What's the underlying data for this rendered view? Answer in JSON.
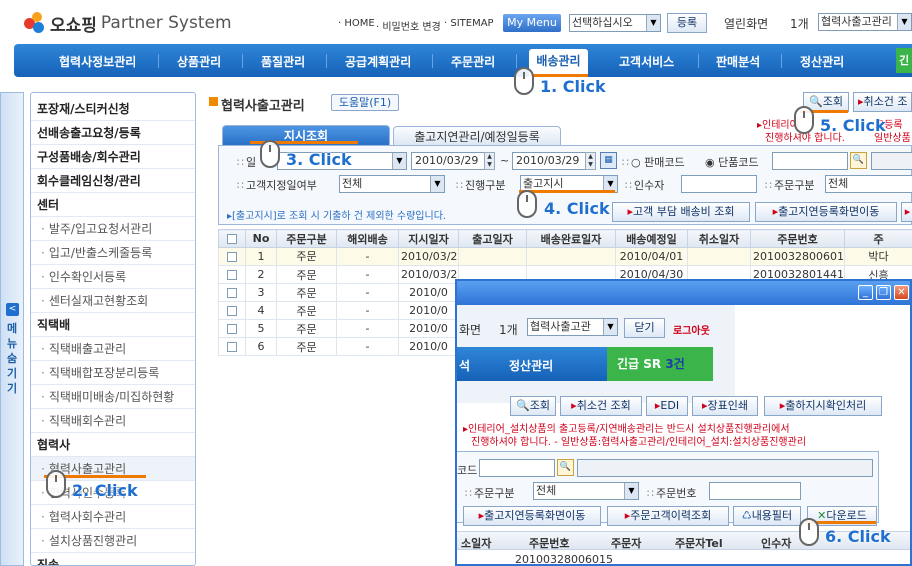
{
  "header": {
    "brand": "오쇼핑",
    "system": "Partner System",
    "links": [
      "HOME",
      "비밀번호 변경",
      "SITEMAP"
    ],
    "my_menu": "My Menu",
    "menu_select": "선택하십시오",
    "register": "등록",
    "open_screens_label": "열린화면",
    "open_screens_count": "1개",
    "open_screen_select": "협력사출고관리"
  },
  "nav": {
    "items": [
      "협력사정보관리",
      "상품관리",
      "품질관리",
      "공급계획관리",
      "주문관리",
      "배송관리",
      "고객서비스",
      "판매분석",
      "정산관리"
    ],
    "active": "배송관리",
    "urgent_prefix": "긴"
  },
  "sidebar": {
    "toggle_label": "메뉴숨기기",
    "items": [
      {
        "label": "포장재/스티커신청",
        "type": "head"
      },
      {
        "label": "선배송출고요청/등록",
        "type": "head"
      },
      {
        "label": "구성품배송/회수관리",
        "type": "head"
      },
      {
        "label": "회수클레임신청/관리",
        "type": "head"
      },
      {
        "label": "센터",
        "type": "head"
      },
      {
        "label": "발주/입고요청서관리",
        "type": "sub"
      },
      {
        "label": "입고/반출스케줄등록",
        "type": "sub"
      },
      {
        "label": "인수확인서등록",
        "type": "sub"
      },
      {
        "label": "센터실재고현황조회",
        "type": "sub"
      },
      {
        "label": "직택배",
        "type": "head"
      },
      {
        "label": "직택배출고관리",
        "type": "sub"
      },
      {
        "label": "직택배합포장분리등록",
        "type": "sub"
      },
      {
        "label": "직택배미배송/미집하현황",
        "type": "sub"
      },
      {
        "label": "직택배회수관리",
        "type": "sub"
      },
      {
        "label": "협력사",
        "type": "head"
      },
      {
        "label": "협력사출고관리",
        "type": "sub"
      },
      {
        "label": "협력사인수등록",
        "type": "sub"
      },
      {
        "label": "협력사회수관리",
        "type": "sub"
      },
      {
        "label": "설치상품진행관리",
        "type": "sub"
      },
      {
        "label": "직송",
        "type": "head"
      }
    ]
  },
  "main": {
    "title": "협력사출고관리",
    "help": "도움말(F1)",
    "search_btn": "조회",
    "cancel_search_btn": "취소건 조",
    "notice_red_1": "인테리어",
    "notice_red_1b": "고등록",
    "notice_red_2": "진행하셔야 합니다.",
    "notice_red_2b": "일반상품",
    "tabs": [
      "지시조회",
      "출고지연관리/예정일등록"
    ],
    "filters": {
      "date_from": "2010/03/29",
      "date_sep": "~",
      "date_to": "2010/03/29",
      "sales_code": "판매코드",
      "single_code": "단품코드",
      "designated_label": "고객지정일여부",
      "designated_value": "전체",
      "status_label": "진행구분",
      "status_value": "출고지시",
      "receiver_label": "인수자",
      "order_type_label": "주문구분",
      "order_type_value": "전체"
    },
    "hint": "[출고지시]로 조회 시 기출하 건 제외한 수량입니다.",
    "actions": [
      "고객 부담 배송비 조회",
      "출고지연등록화면이동"
    ],
    "columns": [
      "",
      "No",
      "주문구분",
      "해외배송",
      "지시일자",
      "출고일자",
      "배송완료일자",
      "배송예정일",
      "취소일자",
      "주문번호",
      "주"
    ],
    "rows": [
      [
        "",
        "1",
        "주문",
        "-",
        "2010/03/29",
        "",
        "",
        "2010/04/01",
        "",
        "20100328006015",
        "박다"
      ],
      [
        "",
        "2",
        "주문",
        "-",
        "2010/03/29",
        "",
        "",
        "2010/04/30",
        "",
        "20100328014417",
        "신흥"
      ],
      [
        "",
        "3",
        "주문",
        "-",
        "2010/0",
        "",
        "",
        "",
        "",
        "",
        ""
      ],
      [
        "",
        "4",
        "주문",
        "-",
        "2010/0",
        "",
        "",
        "",
        "",
        "",
        ""
      ],
      [
        "",
        "5",
        "주문",
        "-",
        "2010/0",
        "",
        "",
        "",
        "",
        "",
        ""
      ],
      [
        "",
        "6",
        "주문",
        "-",
        "2010/0",
        "",
        "",
        "",
        "",
        "",
        ""
      ]
    ]
  },
  "popup": {
    "open_screens": "화면",
    "count": "1개",
    "screen_select": "협력사출고관",
    "close": "닫기",
    "logout": "로그아웃",
    "nav_partial": "석",
    "nav_item": "정산관리",
    "urgent": "긴급 SR",
    "urgent_count": "3건",
    "buttons": [
      "조회",
      "취소건 조회",
      "EDI",
      "장표인쇄",
      "출하지시확인처리"
    ],
    "notice_1": "인테리어_설치상품의 출고등록/지연배송관리는 반드시 설치상품진행관리에서",
    "notice_2": "진행하셔야 합니다. - 일반상품:협력사출고관리/인테리어_설치:설치상품진행관리",
    "code_label": "코드",
    "order_type_label": "주문구분",
    "order_type_value": "전체",
    "order_no_label": "주문번호",
    "actions": [
      "출고지연등록화면이동",
      "주문고객이력조회",
      "내용필터",
      "다운로드"
    ],
    "columns": [
      "소일자",
      "주문번호",
      "주문자",
      "주문자Tel",
      "인수자"
    ],
    "row": [
      "",
      "20100328006015",
      "",
      "",
      ""
    ]
  },
  "steps": [
    "1. Click",
    "2. Click",
    "3. Click",
    "4. Click",
    "5. Click",
    "6. Click"
  ],
  "colors": {
    "accent": "#1f6fd0",
    "nav": "#1562b8",
    "green": "#3bb54a",
    "orange": "#f07a00"
  }
}
